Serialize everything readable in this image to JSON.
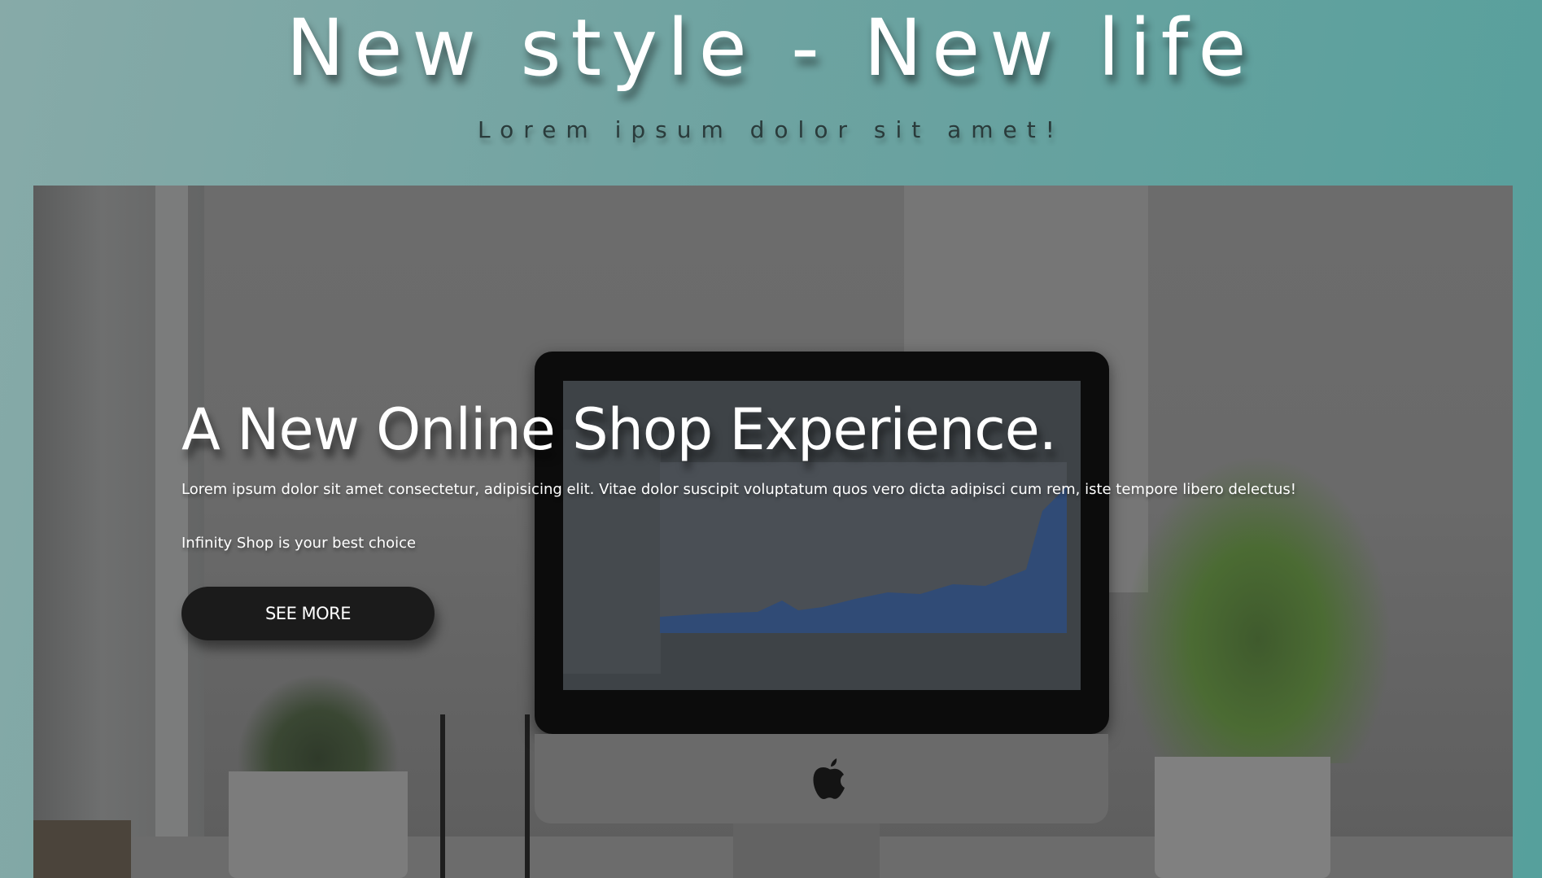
{
  "header": {
    "title": "New style - New life",
    "subtitle": "Lorem ipsum dolor sit amet!"
  },
  "hero": {
    "heading": "A New Online Shop Experience.",
    "description": "Lorem ipsum dolor sit amet consectetur, adipisicing elit. Vitae dolor suscipit voluptatum quos vero dicta adipisci cum rem, iste tempore libero delectus!",
    "tagline": "Infinity Shop is your best choice",
    "button_label": "SEE MORE",
    "background_icon": "apple-logo-icon"
  },
  "colors": {
    "page_gradient_start": "#87aaa8",
    "page_gradient_end": "#56a09c",
    "button_background": "#1b1b1b",
    "text_light": "#ffffff"
  }
}
